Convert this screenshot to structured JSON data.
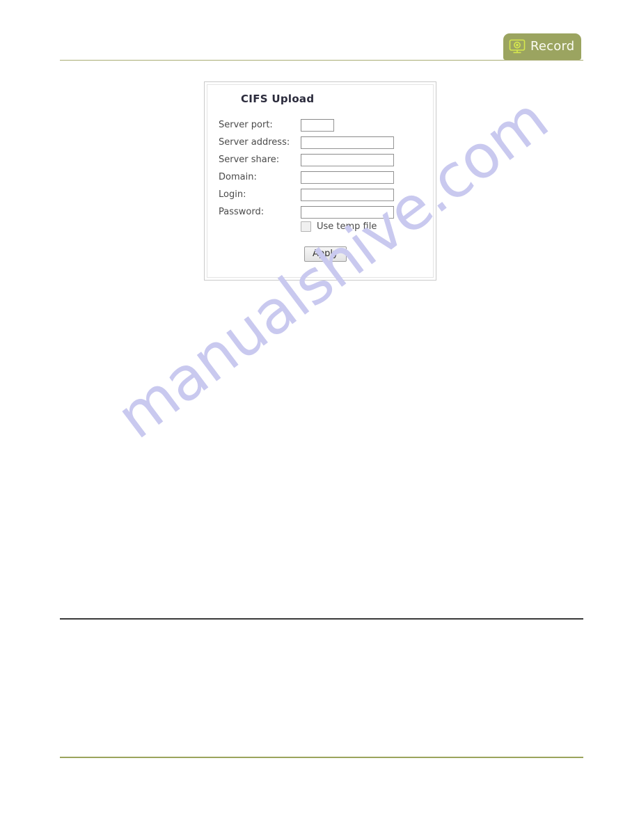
{
  "badge": {
    "label": "Record",
    "icon": "monitor-record-icon",
    "bg_color": "#9ba460",
    "icon_color": "#d6e84e",
    "text_color": "#fbfcf2"
  },
  "panel": {
    "title": "CIFS Upload",
    "fields": [
      {
        "label": "Server port:",
        "value": "",
        "placeholder": "",
        "width": "narrow",
        "name": "server-port"
      },
      {
        "label": "Server address:",
        "value": "",
        "placeholder": "",
        "width": "wide",
        "name": "server-address"
      },
      {
        "label": "Server share:",
        "value": "",
        "placeholder": "",
        "width": "wide",
        "name": "server-share"
      },
      {
        "label": "Domain:",
        "value": "",
        "placeholder": "",
        "width": "wide",
        "name": "domain"
      },
      {
        "label": "Login:",
        "value": "",
        "placeholder": "",
        "width": "wide",
        "name": "login"
      },
      {
        "label": "Password:",
        "value": "",
        "placeholder": "",
        "width": "wide",
        "name": "password"
      }
    ],
    "checkbox": {
      "label": "Use temp file",
      "checked": false
    },
    "apply_label": "Apply"
  },
  "watermark": {
    "text": "manualshive.com",
    "color": "#c9c9ef"
  },
  "rules": {
    "top_color": "#a9ad74",
    "middle_color": "#3a3a3a",
    "bottom_color": "#9ba45c"
  }
}
